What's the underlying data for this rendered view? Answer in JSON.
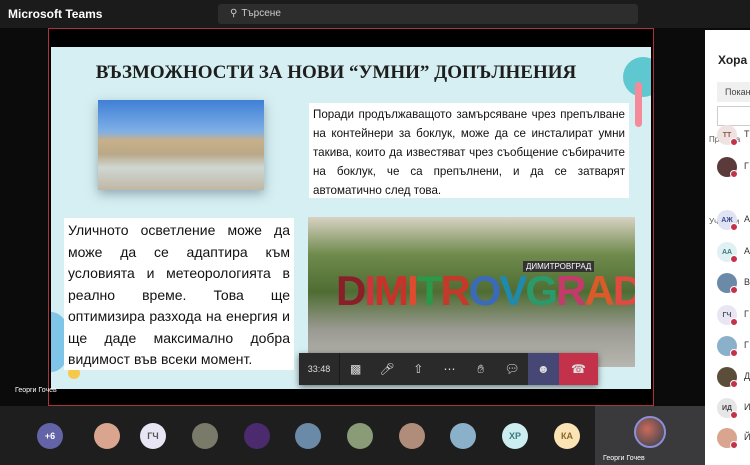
{
  "app": {
    "title": "Microsoft Teams",
    "search_placeholder": "Търсене"
  },
  "slide": {
    "title": "ВЪЗМОЖНОСТИ ЗА НОВИ “УМНИ” ДОПЪЛНЕНИЯ",
    "text_right": "Поради продължаващото замърсяване чрез препълване на контейнери за боклук, може да се инсталират умни такива, които да известяват чрез съобщение събирачите на боклук, че са препълнени, и да се затварят автоматично след това.",
    "text_left": "Уличното осветление може да може да се адаптира към условията и метеорологията в реално време. Това ще оптимизира разхода на енергия и ще даде максимално добра видимост във всеки момент.",
    "photo_sign": "DIMITROVGRAD",
    "photo_sign_small": "ДИМИТРОВГРАД"
  },
  "presenter_name": "Георги Гочев",
  "controls": {
    "timer": "33:48"
  },
  "gallery": [
    {
      "label": "+6",
      "bg": "#6264a7",
      "fg": "#fff"
    },
    {
      "label": "",
      "bg": "#d9a58f"
    },
    {
      "label": "ГЧ",
      "bg": "#e8e6f5",
      "fg": "#555"
    },
    {
      "label": "",
      "bg": "#7a7a6a"
    },
    {
      "label": "",
      "bg": "#4b2a6e"
    },
    {
      "label": "",
      "bg": "#6b8aa8"
    },
    {
      "label": "",
      "bg": "#8a9b78"
    },
    {
      "label": "",
      "bg": "#b08d7a"
    },
    {
      "label": "",
      "bg": "#8bb0c9"
    },
    {
      "label": "ХР",
      "bg": "#cdeef0",
      "fg": "#3b7a80"
    },
    {
      "label": "КА",
      "bg": "#fbe3b6",
      "fg": "#8a6a2a"
    }
  ],
  "self_tile": {
    "name": "Георги Гочев"
  },
  "panel": {
    "title": "Хора",
    "invite": "Покан",
    "section_presenters": "Предста",
    "section_attendees": "Участни",
    "people": [
      {
        "initials": "ТТ",
        "name": "Т",
        "bg": "#eee3e0",
        "fg": "#8a5a50"
      },
      {
        "initials": "",
        "name": "Г",
        "bg": "#5a3a3a"
      },
      {
        "initials": "АЖ",
        "name": "А",
        "bg": "#dfe3f3",
        "fg": "#3b4a8a"
      },
      {
        "initials": "АА",
        "name": "А",
        "bg": "#dff1f3",
        "fg": "#3b7a80"
      },
      {
        "initials": "",
        "name": "В",
        "bg": "#6b8aa8"
      },
      {
        "initials": "ГЧ",
        "name": "Г",
        "bg": "#e8e6f5",
        "fg": "#555"
      },
      {
        "initials": "",
        "name": "Г",
        "bg": "#8bb0c9"
      },
      {
        "initials": "",
        "name": "Д",
        "bg": "#5a4e3a"
      },
      {
        "initials": "ИД",
        "name": "И",
        "bg": "#e6e6e6",
        "fg": "#444"
      },
      {
        "initials": "",
        "name": "Й",
        "bg": "#d9a58f"
      }
    ]
  }
}
